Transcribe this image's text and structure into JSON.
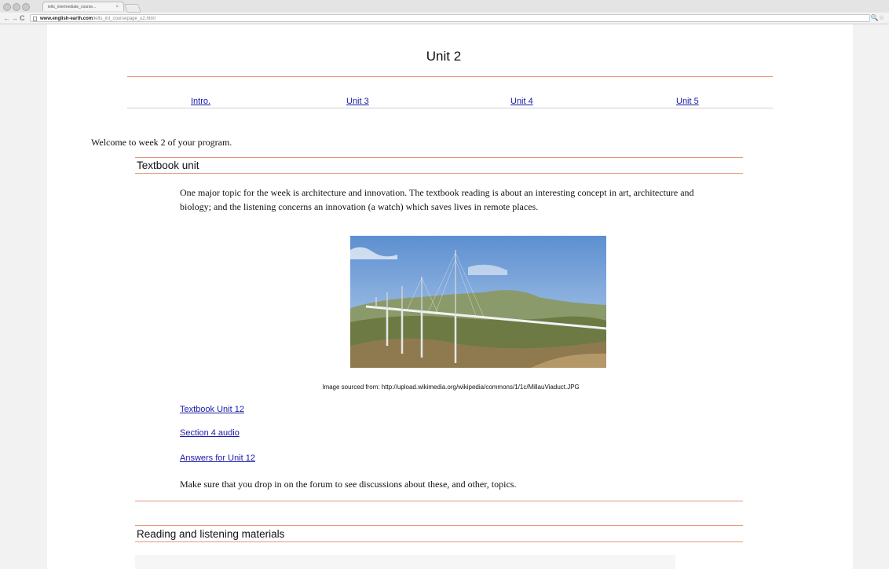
{
  "browser": {
    "tab_title": "ielts_intermediate_course...",
    "tab_close": "×",
    "url_host": "www.english-earth.com",
    "url_path": "/ielts_int_coursepage_u2.html",
    "back_icon": "←",
    "forward_icon": "→",
    "reload_icon": "C",
    "toolbar_icons": "🔍☆"
  },
  "page": {
    "title": "Unit 2",
    "nav": [
      {
        "label": "Intro."
      },
      {
        "label": "Unit 3"
      },
      {
        "label": "Unit 4"
      },
      {
        "label": "Unit 5"
      }
    ],
    "welcome": "Welcome to week 2 of your program.",
    "textbook_section": {
      "heading": "Textbook unit",
      "paragraph": "One major topic for the week is architecture and innovation. The textbook reading is about an interesting concept in art, architecture and biology; and the listening concerns an innovation (a watch) which saves lives in remote places.",
      "image_caption": "Image sourced from: http://upload.wikimedia.org/wikipedia/commons/1/1c/MillauViaduct.JPG",
      "links": [
        {
          "label": "Textbook Unit 12"
        },
        {
          "label": "Section 4 audio"
        },
        {
          "label": "Answers for Unit 12"
        }
      ],
      "forum_note": "Make sure that you drop in on the forum to see discussions about these, and other, topics."
    },
    "reading_section": {
      "heading": "Reading and listening materials"
    }
  },
  "colors": {
    "accent_rule": "#e6947a",
    "link": "#1a1aa8"
  }
}
